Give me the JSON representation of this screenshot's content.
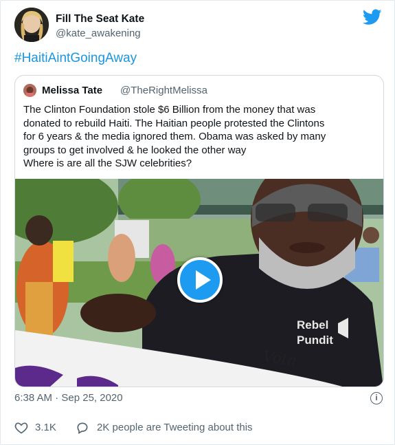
{
  "tweet": {
    "author_name": "Fill The Seat Kate",
    "author_handle": "@kate_awakening",
    "hashtag": "#HaitiAintGoingAway",
    "timestamp": "6:38 AM · Sep 25, 2020",
    "likes": "3.1K",
    "talking": "2K people are Tweeting about this"
  },
  "quoted": {
    "name": "Melissa Tate",
    "handle": "@TheRightMelissa",
    "text_lines": [
      "The Clinton Foundation stole $6 Billion from the money that was",
      "donated to rebuild Haiti. The Haitian people protested the Clintons",
      "for 6 years & the media ignored them. Obama was asked by many",
      "groups to get involved & he looked the other way",
      "Where is are all the SJW celebrities?"
    ],
    "media": {
      "type": "video",
      "shirt_text": "Rebel Pundit",
      "sign_text": "Vota"
    }
  },
  "colors": {
    "brand_blue": "#1d9bf0",
    "link_blue": "#1b95e0",
    "muted": "#536471"
  },
  "icons": {
    "brand": "twitter-bird-icon",
    "play": "play-icon",
    "info": "info-icon",
    "like": "heart-icon",
    "reply": "speech-bubble-icon"
  }
}
